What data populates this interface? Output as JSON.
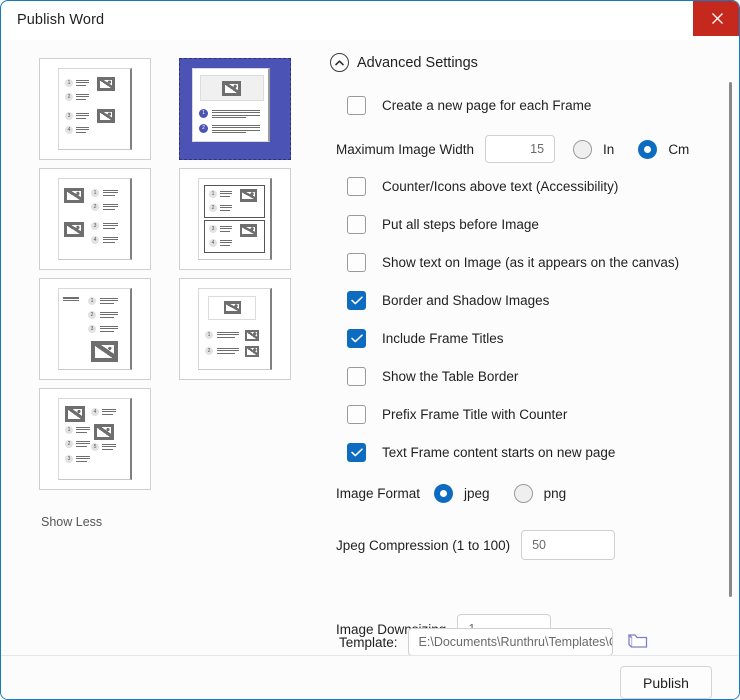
{
  "window": {
    "title": "Publish Word",
    "close_label": "Close"
  },
  "gallery": {
    "show_less_label": "Show Less",
    "templates": [
      {
        "name": "two-column-numbered-images-right",
        "selected": false
      },
      {
        "name": "image-top-numbered-lines-below",
        "selected": true
      },
      {
        "name": "images-left-numbered-lines-right",
        "selected": false
      },
      {
        "name": "boxed-two-row-steps",
        "selected": false
      },
      {
        "name": "numbered-steps-large-image-bottom",
        "selected": false
      },
      {
        "name": "image-header-two-steps-thumbnails",
        "selected": false
      },
      {
        "name": "mixed-five-step-layout",
        "selected": false
      }
    ]
  },
  "settings": {
    "header_label": "Advanced Settings",
    "header_icon": "chevron-up-circle-icon",
    "checkboxes": [
      {
        "label": "Create a new page for each Frame",
        "checked": false,
        "name": "create-new-page-for-each-frame"
      },
      {
        "label": "Counter/Icons above text (Accessibility)",
        "checked": false,
        "name": "counter-icons-above-text"
      },
      {
        "label": "Put all steps before Image",
        "checked": false,
        "name": "put-all-steps-before-image"
      },
      {
        "label": "Show text on Image (as it appears on the canvas)",
        "checked": false,
        "name": "show-text-on-image"
      },
      {
        "label": "Border and Shadow Images",
        "checked": true,
        "name": "border-and-shadow-images"
      },
      {
        "label": "Include Frame Titles",
        "checked": true,
        "name": "include-frame-titles"
      },
      {
        "label": "Show the Table Border",
        "checked": false,
        "name": "show-the-table-border"
      },
      {
        "label": "Prefix Frame Title with Counter",
        "checked": false,
        "name": "prefix-frame-title-with-counter"
      },
      {
        "label": "Text Frame content starts on new page",
        "checked": true,
        "name": "text-frame-content-starts-on-new-page"
      }
    ],
    "max_image_width": {
      "label": "Maximum Image Width",
      "value": "15",
      "units": [
        {
          "label": "In",
          "selected": false
        },
        {
          "label": "Cm",
          "selected": true
        }
      ]
    },
    "image_format": {
      "label": "Image Format",
      "options": [
        {
          "label": "jpeg",
          "selected": true
        },
        {
          "label": "png",
          "selected": false
        }
      ]
    },
    "jpeg_compression": {
      "label": "Jpeg Compression (1 to 100)",
      "value": "50"
    },
    "image_downsizing": {
      "label": "Image Downsizing",
      "value": "1"
    },
    "template": {
      "label": "Template:",
      "value": "E:\\Documents\\Runthru\\Templates\\C",
      "browse_icon": "folder-icon"
    }
  },
  "footer": {
    "publish_label": "Publish"
  },
  "colors": {
    "window_border": "#1579c4",
    "close_red": "#c5281c",
    "accent_blue": "#0d6cbf",
    "selection_purple": "#4b53b4"
  }
}
